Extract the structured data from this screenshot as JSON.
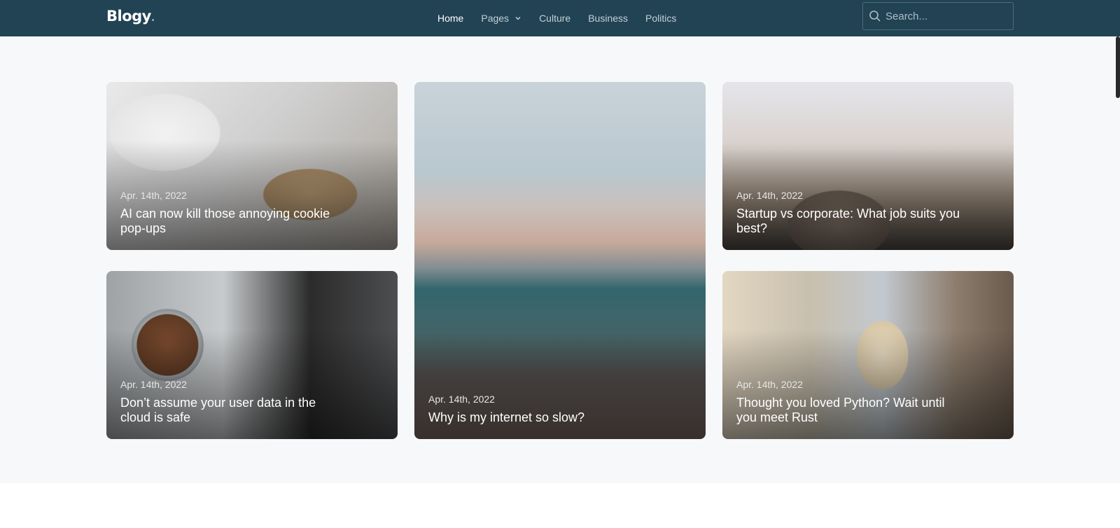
{
  "header": {
    "logo": "Blogy",
    "logo_dot": ".",
    "nav": [
      {
        "label": "Home",
        "active": true
      },
      {
        "label": "Pages",
        "has_dropdown": true
      },
      {
        "label": "Culture"
      },
      {
        "label": "Business"
      },
      {
        "label": "Politics"
      }
    ],
    "search": {
      "placeholder": "Search...",
      "icon": "search-icon"
    }
  },
  "posts": [
    {
      "date": "Apr. 14th, 2022",
      "title": "AI can now kill those annoying cookie pop-ups"
    },
    {
      "date": "Apr. 14th, 2022",
      "title": "Why is my internet so slow?"
    },
    {
      "date": "Apr. 14th, 2022",
      "title": "Startup vs corporate: What job suits you best?"
    },
    {
      "date": "Apr. 14th, 2022",
      "title": "Don’t assume your user data in the cloud is safe"
    },
    {
      "date": "Apr. 14th, 2022",
      "title": "Thought you loved Python? Wait until you meet Rust"
    }
  ],
  "colors": {
    "header_bg": "#214354",
    "page_bg": "#f7f8fa",
    "nav_active": "#ffffff",
    "nav_default": "#c3d0d7"
  }
}
